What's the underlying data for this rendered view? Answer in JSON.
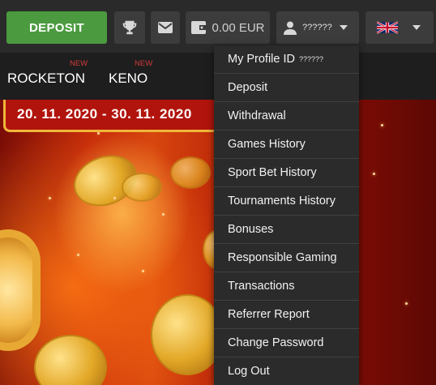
{
  "header": {
    "deposit_label": "DEPOSIT",
    "balance": "0.00 EUR",
    "username": "??????",
    "language_flag": "uk-flag-icon"
  },
  "nav": {
    "items": [
      {
        "label": "ROCKETON",
        "badge": "NEW"
      },
      {
        "label": "KENO",
        "badge": "NEW"
      }
    ]
  },
  "banner": {
    "date_range": "20. 11. 2020 - 30. 11. 2020"
  },
  "account_menu": {
    "profile_label": "My Profile ID",
    "profile_id": "??????",
    "items": [
      "Deposit",
      "Withdrawal",
      "Games History",
      "Sport Bet History",
      "Tournaments History",
      "Bonuses",
      "Responsible Gaming",
      "Transactions",
      "Referrer Report",
      "Change Password",
      "Log Out"
    ]
  },
  "colors": {
    "deposit_green": "#4b9a3f",
    "new_badge_red": "#d23a3a",
    "menu_bg": "#2b2b2b",
    "topbar_bg": "#2a2a2a"
  }
}
